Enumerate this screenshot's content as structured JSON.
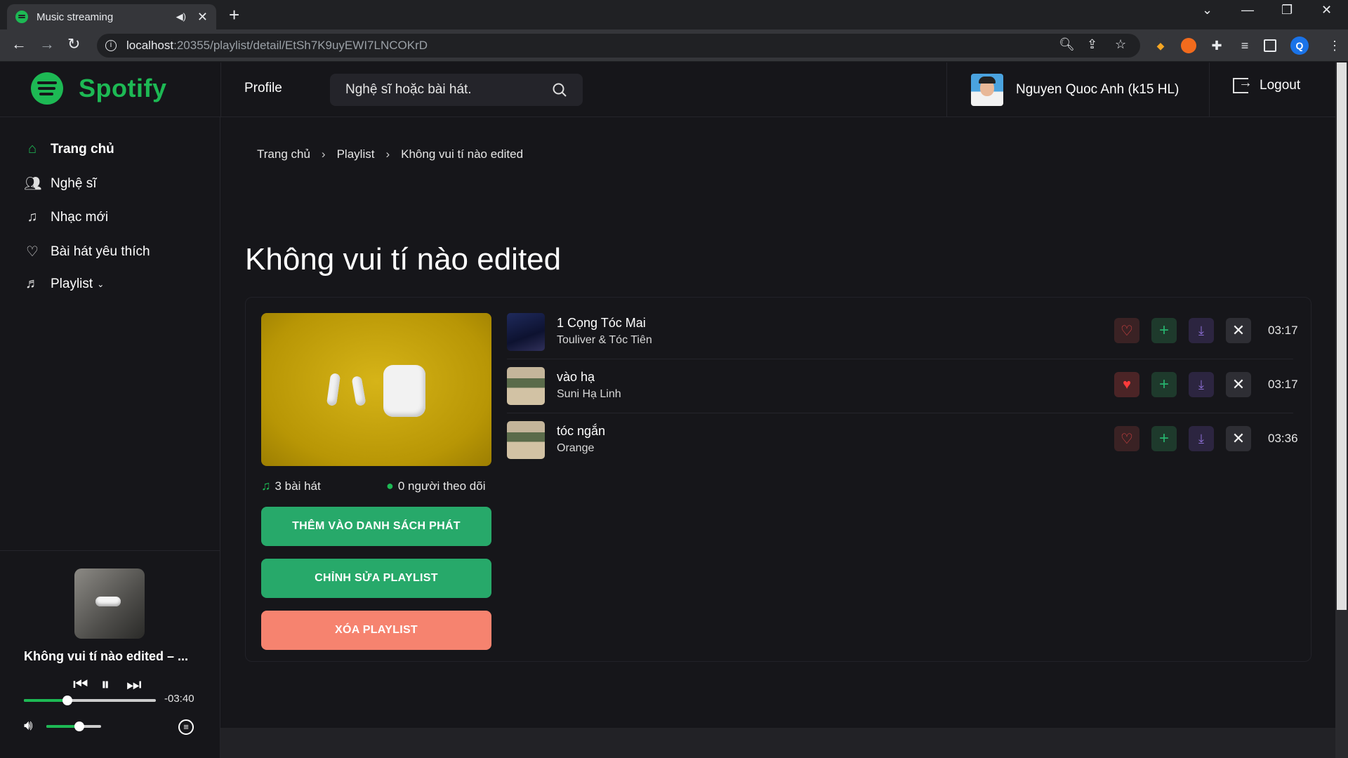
{
  "browser": {
    "tab_title": "Music streaming",
    "url_host": "localhost",
    "url_rest": ":20355/playlist/detail/EtSh7K9uyEWI7LNCOKrD",
    "profile_initial": "Q"
  },
  "header": {
    "logo": "Spotify",
    "profile_link": "Profile",
    "search_placeholder": "Nghệ sĩ hoặc bài hát.",
    "user_name": "Nguyen Quoc Anh (k15 HL)",
    "logout": "Logout"
  },
  "sidebar": {
    "items": [
      {
        "label": "Trang chủ",
        "icon": "home-icon"
      },
      {
        "label": "Nghệ sĩ",
        "icon": "users-icon"
      },
      {
        "label": "Nhạc mới",
        "icon": "music-note-icon"
      },
      {
        "label": "Bài hát yêu thích",
        "icon": "heart-icon"
      },
      {
        "label": "Playlist",
        "icon": "playlist-icon"
      }
    ]
  },
  "player": {
    "now_playing": "Không vui tí nào edited – ...",
    "remaining": "-03:40",
    "progress_fraction": 0.33,
    "volume_fraction": 0.6
  },
  "breadcrumb": [
    "Trang chủ",
    "Playlist",
    "Không vui tí nào edited"
  ],
  "playlist": {
    "title": "Không vui tí nào edited",
    "song_count": "3 bài hát",
    "followers": "0 người theo dõi",
    "buttons": {
      "add": "THÊM VÀO DANH SÁCH PHÁT",
      "edit": "CHỈNH SỬA PLAYLIST",
      "delete": "XÓA PLAYLIST"
    },
    "songs": [
      {
        "title": "1 Cọng Tóc Mai",
        "artist": "Touliver & Tóc Tiên",
        "duration": "03:17",
        "liked": false
      },
      {
        "title": "vào hạ",
        "artist": "Suni Hạ Linh",
        "duration": "03:17",
        "liked": true
      },
      {
        "title": "tóc ngắn",
        "artist": "Orange",
        "duration": "03:36",
        "liked": false
      }
    ]
  },
  "colors": {
    "accent_green": "#1db954",
    "button_green": "#27a96a",
    "button_delete": "#f6836f",
    "background": "#16161a"
  }
}
